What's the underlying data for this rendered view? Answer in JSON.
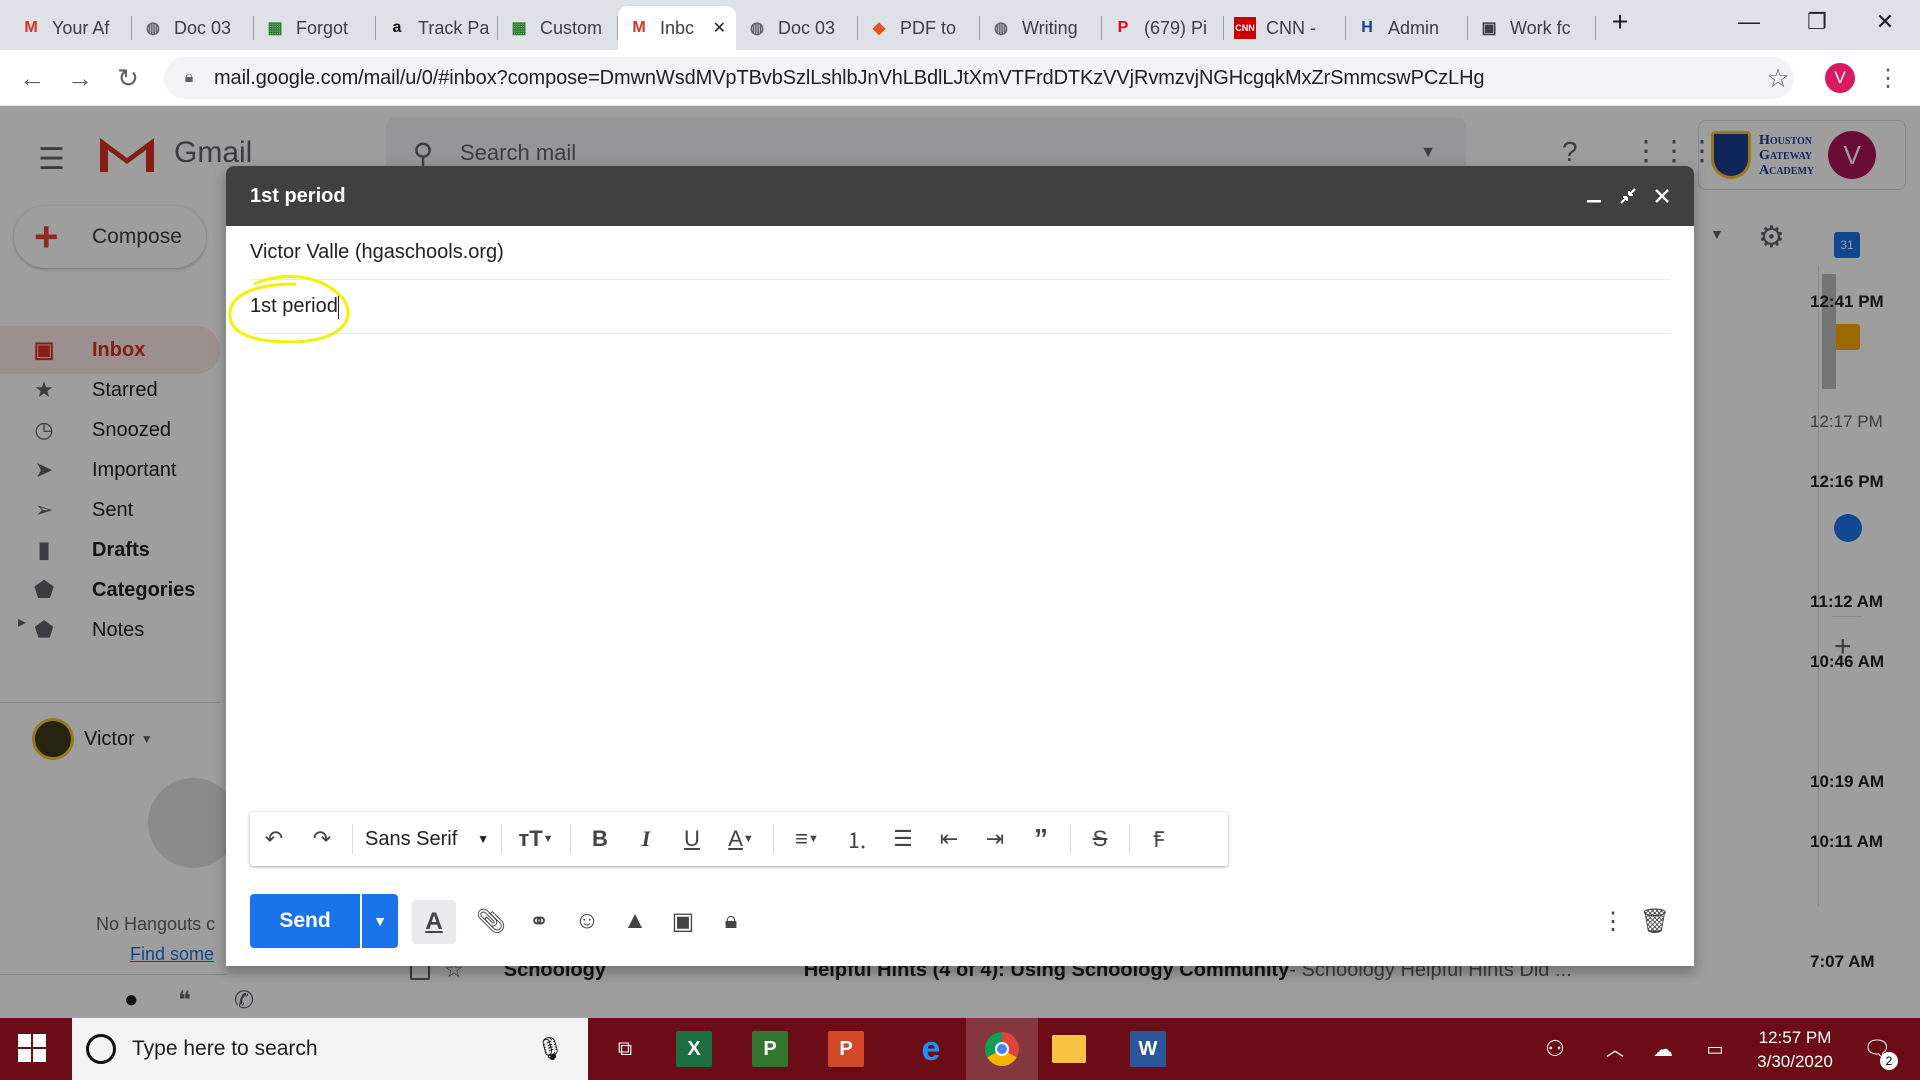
{
  "browser": {
    "tabs": [
      {
        "label": "Your Af",
        "icon": "gmail-icon",
        "glyph": "M",
        "color": "#d93025"
      },
      {
        "label": "Doc 03",
        "icon": "globe-icon",
        "glyph": "◍",
        "color": "#5f6368"
      },
      {
        "label": "Forgot",
        "icon": "page-icon",
        "glyph": "▦",
        "color": "#2e7d32"
      },
      {
        "label": "Track Pa",
        "icon": "amazon-icon",
        "glyph": "a",
        "color": "#111"
      },
      {
        "label": "Custom",
        "icon": "page-icon",
        "glyph": "▦",
        "color": "#2e7d32"
      },
      {
        "label": "Inbc",
        "icon": "gmail-icon",
        "glyph": "M",
        "color": "#d93025"
      },
      {
        "label": "Doc 03",
        "icon": "globe-icon",
        "glyph": "◍",
        "color": "#5f6368"
      },
      {
        "label": "PDF to",
        "icon": "pdf-icon",
        "glyph": "◆",
        "color": "#e8541e"
      },
      {
        "label": "Writing",
        "icon": "globe-icon",
        "glyph": "◍",
        "color": "#5f6368"
      },
      {
        "label": "(679) Pi",
        "icon": "pinterest-icon",
        "glyph": "P",
        "color": "#e60023"
      },
      {
        "label": "CNN -",
        "icon": "cnn-icon",
        "glyph": "CNN",
        "color": "#cc0000"
      },
      {
        "label": "Admin",
        "icon": "h-icon",
        "glyph": "H",
        "color": "#1a3d8f"
      },
      {
        "label": "Work fc",
        "icon": "classroom-icon",
        "glyph": "▣",
        "color": "#3c4043"
      }
    ],
    "new_tab": "+",
    "url": "mail.google.com/mail/u/0/#inbox?compose=DmwnWsdMVpTBvbSzlLshlbJnVhLBdlLJtXmVTFrdDTKzVVjRvmzvjNGHcgqkMxZrSmmcswPCzLHg",
    "profile_initial": "V"
  },
  "gmail": {
    "app_name": "Gmail",
    "search_placeholder": "Search mail",
    "compose_label": "Compose",
    "nav": [
      {
        "label": "Inbox",
        "icon": "inbox-icon",
        "glyph": "▣"
      },
      {
        "label": "Starred",
        "icon": "star-icon",
        "glyph": "★"
      },
      {
        "label": "Snoozed",
        "icon": "clock-icon",
        "glyph": "◷"
      },
      {
        "label": "Important",
        "icon": "important-icon",
        "glyph": "➤"
      },
      {
        "label": "Sent",
        "icon": "send-icon",
        "glyph": "➢"
      },
      {
        "label": "Drafts",
        "icon": "draft-icon",
        "glyph": "▮"
      },
      {
        "label": "Categories",
        "icon": "label-icon",
        "glyph": "⬟"
      },
      {
        "label": "Notes",
        "icon": "label-icon",
        "glyph": "⬟"
      }
    ],
    "hangouts_user": "Victor",
    "no_hangouts": "No Hangouts c",
    "find_someone": "Find some",
    "school_name": {
      "l1": "Houston",
      "l2": "Gateway",
      "l3": "Academy"
    },
    "times": [
      "12:41 PM",
      "12:17 PM",
      "12:16 PM",
      "11:12 AM",
      "10:46 AM",
      "10:19 AM",
      "10:11 AM",
      "7:07 AM"
    ],
    "bottom_row": {
      "sender": "Schoology",
      "subject": "Helpful Hints (4 of 4): Using Schoology Community",
      "snippet": " - Schoology Helpful Hints Did ..."
    }
  },
  "compose": {
    "title": "1st period",
    "from": "Victor Valle (hgaschools.org)",
    "subject": "1st period",
    "font": "Sans Serif",
    "send_label": "Send"
  },
  "taskbar": {
    "search_placeholder": "Type here to search",
    "time": "12:57 PM",
    "date": "3/30/2020",
    "notifications": "2"
  }
}
